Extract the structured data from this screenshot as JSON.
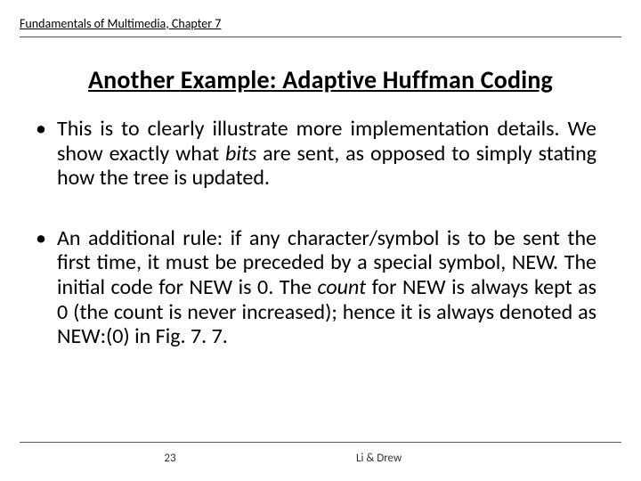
{
  "header": {
    "text": "Fundamentals of Multimedia, Chapter 7"
  },
  "title": "Another Example: Adaptive Huffman Coding",
  "bullets": [
    {
      "prefix": "This is to clearly illustrate more implementation details. We show exactly what ",
      "em1": "bits",
      "suffix": " are sent, as opposed to simply stating how the tree is updated.",
      "has_em2": false
    },
    {
      "prefix": "An additional rule: if any character/symbol is to be sent the first time, it must be preceded by a special symbol, NEW.  The initial code for NEW is 0. The ",
      "em1": "count",
      "mid": " for NEW is always kept as 0 (the count is never increased); hence it is always denoted as NEW:(0) in Fig. 7. 7.",
      "has_em2": false
    }
  ],
  "footer": {
    "page": "23",
    "authors": "Li & Drew"
  }
}
